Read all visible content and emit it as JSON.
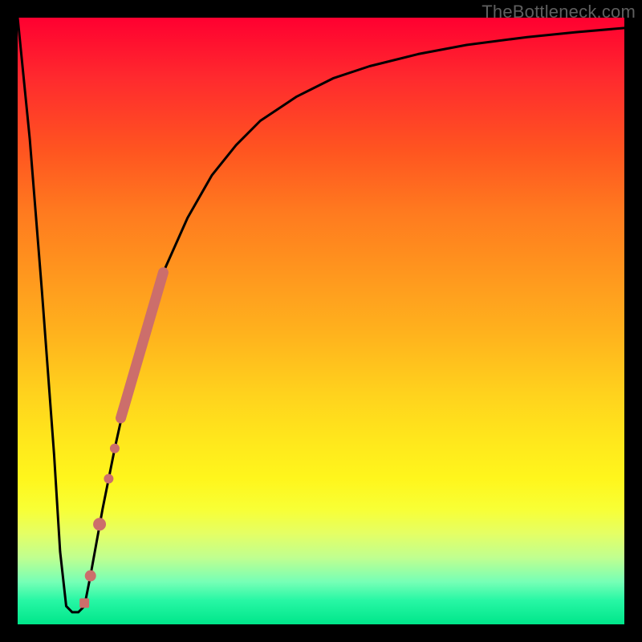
{
  "watermark": "TheBottleneck.com",
  "colors": {
    "curve_stroke": "#000000",
    "marker_fill": "#cc6e6b",
    "frame": "#000000"
  },
  "chart_data": {
    "type": "line",
    "title": "",
    "xlabel": "",
    "ylabel": "",
    "xlim": [
      0,
      100
    ],
    "ylim": [
      0,
      100
    ],
    "grid": false,
    "series": [
      {
        "name": "bottleneck_curve",
        "x": [
          0,
          2,
          4,
          6,
          7,
          8,
          9,
          10,
          11,
          12,
          14,
          16,
          18,
          20,
          24,
          28,
          32,
          36,
          40,
          46,
          52,
          58,
          66,
          74,
          84,
          92,
          100
        ],
        "y": [
          100,
          80,
          55,
          28,
          12,
          3,
          2,
          2,
          3,
          8,
          19,
          29,
          38,
          46,
          58,
          67,
          74,
          79,
          83,
          87,
          90,
          92,
          94,
          95.5,
          96.8,
          97.6,
          98.3
        ]
      }
    ],
    "markers": [
      {
        "name": "bar_segment",
        "x0": 17.0,
        "y0": 34.0,
        "x1": 24.0,
        "y1": 58.0,
        "width": 13
      },
      {
        "name": "dot1",
        "x": 16.0,
        "y": 29.0,
        "r": 6
      },
      {
        "name": "dot2",
        "x": 15.0,
        "y": 24.0,
        "r": 6
      },
      {
        "name": "dot3",
        "x": 13.5,
        "y": 16.5,
        "r": 8
      },
      {
        "name": "dot4",
        "x": 12.0,
        "y": 8.0,
        "r": 7
      },
      {
        "name": "dot5_square",
        "x": 11.0,
        "y": 3.5,
        "r": 6,
        "shape": "square"
      }
    ]
  }
}
